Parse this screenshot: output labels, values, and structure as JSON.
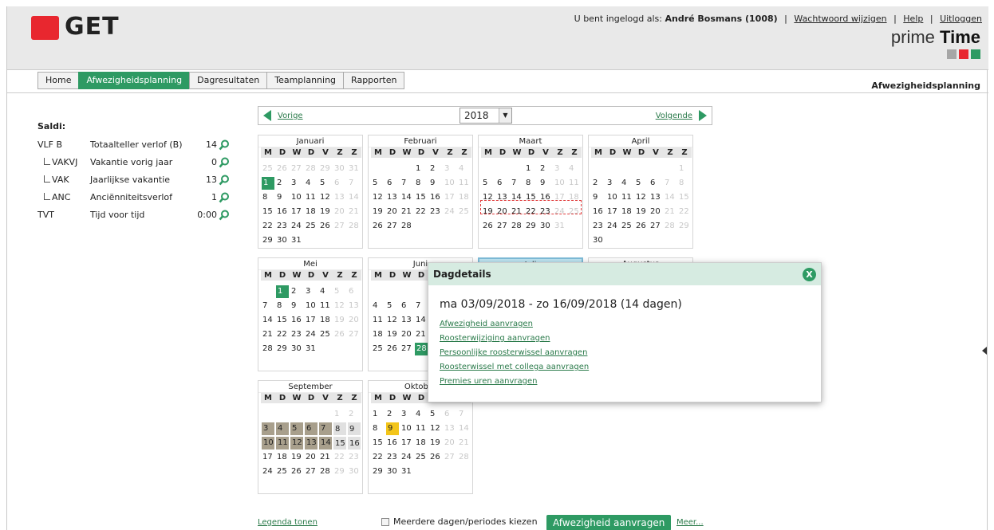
{
  "header": {
    "logo_text": "GET",
    "user_prefix": "U bent ingelogd als:",
    "user_name": "André Bosmans (1008)",
    "links": [
      "Wachtwoord wijzigen",
      "Help",
      "Uitloggen"
    ],
    "brand_light": "prime",
    "brand_bold": "Time",
    "brand_colors": [
      "#a6a6a6",
      "#e8272f",
      "#2e9a63"
    ]
  },
  "tabs": [
    {
      "label": "Home",
      "active": false
    },
    {
      "label": "Afwezigheidsplanning",
      "active": true
    },
    {
      "label": "Dagresultaten",
      "active": false
    },
    {
      "label": "Teamplanning",
      "active": false
    },
    {
      "label": "Rapporten",
      "active": false
    }
  ],
  "page_title": "Afwezigheidsplanning",
  "saldi": {
    "title": "Saldi:",
    "rows": [
      {
        "code": "VLF B",
        "desc": "Totaalteller verlof (B)",
        "value": "14",
        "child": false
      },
      {
        "code": "VAKVJ",
        "desc": "Vakantie vorig jaar",
        "value": "0",
        "child": true
      },
      {
        "code": "VAK",
        "desc": "Jaarlijkse vakantie",
        "value": "13",
        "child": true
      },
      {
        "code": "ANC",
        "desc": "Anciënniteitsverlof",
        "value": "1",
        "child": true
      },
      {
        "code": "TVT",
        "desc": "Tijd voor tijd",
        "value": "0:00",
        "child": false
      }
    ]
  },
  "nav": {
    "prev": "Vorige",
    "next": "Volgende",
    "year": "2018"
  },
  "day_headers": [
    "M",
    "D",
    "W",
    "D",
    "V",
    "Z",
    "Z"
  ],
  "months": [
    {
      "name": "Januari",
      "lead": [
        25,
        26,
        27,
        28,
        29,
        30,
        31
      ],
      "days": 31,
      "start": 0,
      "marks": {
        "1": "g"
      }
    },
    {
      "name": "Februari",
      "lead": [],
      "days": 28,
      "start": 3,
      "marks": {}
    },
    {
      "name": "Maart",
      "lead": [],
      "days": 31,
      "start": 3,
      "marks": {}
    },
    {
      "name": "April",
      "lead": [],
      "days": 30,
      "start": 6,
      "marks": {}
    },
    {
      "name": "Mei",
      "lead": [],
      "days": 31,
      "start": 1,
      "marks": {
        "1": "g"
      }
    },
    {
      "name": "Juni",
      "lead": [],
      "days": 30,
      "start": 4,
      "marks": {
        "28": "g"
      }
    },
    {
      "name": "Juli",
      "lead": [],
      "days": 31,
      "start": 6,
      "marks": {
        "2": "g",
        "3": "gk",
        "4": "g",
        "5": "g",
        "6": "g",
        "21": "b"
      }
    },
    {
      "name": "Augustus",
      "lead": [],
      "days": 31,
      "start": 2,
      "marks": {
        "15": "b"
      }
    },
    {
      "name": "September",
      "lead": [],
      "days": 30,
      "start": 5,
      "marks": {
        "3": "t",
        "4": "t",
        "5": "t",
        "6": "t",
        "7": "t",
        "8": "gr",
        "9": "gr",
        "10": "t",
        "11": "t",
        "12": "t",
        "13": "t",
        "14": "t",
        "15": "gr",
        "16": "gr"
      }
    },
    {
      "name": "Oktober",
      "lead": [],
      "days": 31,
      "start": 0,
      "marks": {
        "9": "y"
      }
    }
  ],
  "popup": {
    "title": "Dagdetails",
    "period": "ma 03/09/2018 - zo 16/09/2018 (14 dagen)",
    "links": [
      "Afwezigheid aanvragen",
      "Roosterwijziging aanvragen",
      "Persoonlijke roosterwissel aanvragen",
      "Roosterwissel met collega aanvragen",
      "Premies uren aanvragen"
    ]
  },
  "footer": {
    "legend": "Legenda tonen",
    "multi": "Meerdere dagen/periodes kiezen",
    "request_button": "Afwezigheid aanvragen",
    "more": "Meer..."
  }
}
